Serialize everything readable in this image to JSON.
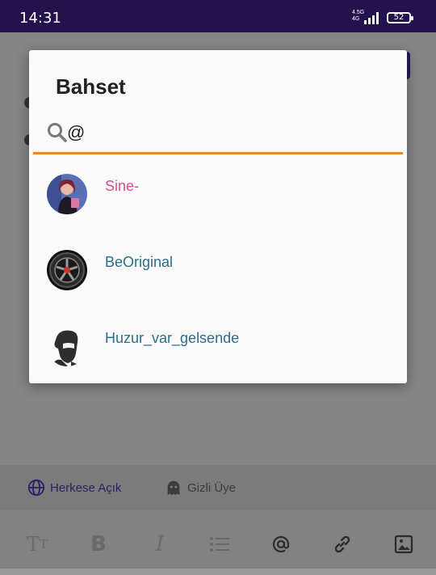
{
  "status_bar": {
    "time": "14:31",
    "network_top": "4.5G",
    "network_bottom": "4G",
    "battery": "52"
  },
  "dialog": {
    "title": "Bahset",
    "search_value": "@",
    "underline_color": "#e08a2c",
    "users": [
      {
        "name": "Sine-",
        "color": "#d64b94",
        "avatar": "woman-photo-avatar"
      },
      {
        "name": "BeOriginal",
        "color": "#2c6e8a",
        "avatar": "car-wheel-avatar"
      },
      {
        "name": "Huzur_var_gelsende",
        "color": "#2c6e8a",
        "avatar": "bearded-man-avatar"
      }
    ]
  },
  "background": {
    "privacy_public_label": "Herkese Açık",
    "privacy_hidden_label": "Gizli Üye",
    "toolbar": [
      "text-size-icon",
      "bold-icon",
      "italic-icon",
      "list-icon",
      "mention-icon",
      "link-icon",
      "image-icon"
    ]
  }
}
